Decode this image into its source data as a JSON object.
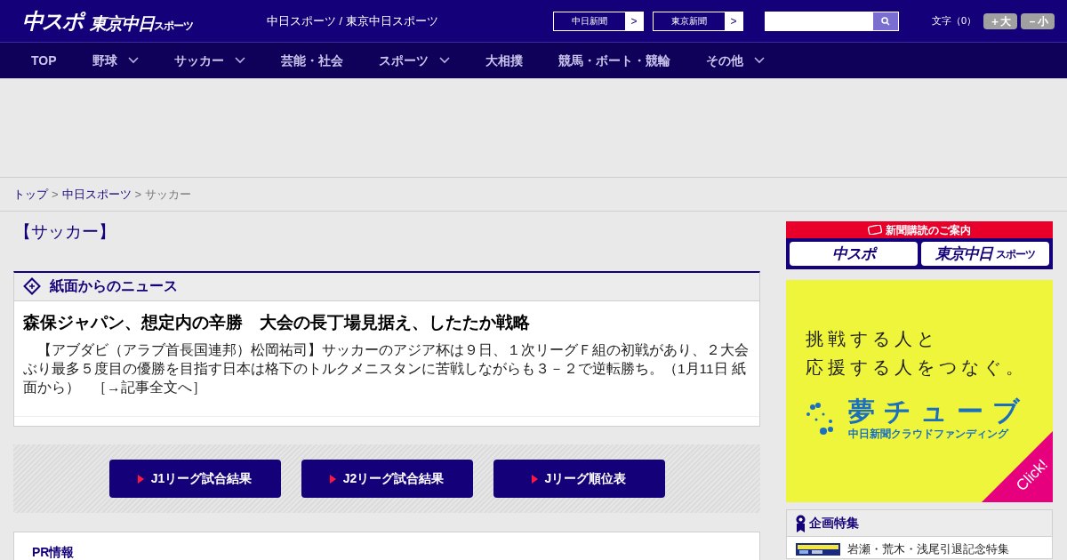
{
  "header": {
    "logo_main": "中スポ",
    "logo_tokyo": "東京中日",
    "logo_tokyo_small": "スポーツ",
    "site_title": "中日スポーツ / 東京中日スポーツ",
    "links": [
      {
        "label": "中日新聞",
        "arrow": ">"
      },
      {
        "label": "東京新聞",
        "arrow": ">"
      }
    ],
    "font_size": {
      "label": "文字（0）",
      "buttons": [
        "＋大",
        "－小"
      ]
    }
  },
  "nav": [
    {
      "label": "TOP",
      "dropdown": false
    },
    {
      "label": "野球",
      "dropdown": true
    },
    {
      "label": "サッカー",
      "dropdown": true
    },
    {
      "label": "芸能・社会",
      "dropdown": false
    },
    {
      "label": "スポーツ",
      "dropdown": true
    },
    {
      "label": "大相撲",
      "dropdown": false
    },
    {
      "label": "競馬・ボート・競輪",
      "dropdown": false
    },
    {
      "label": "その他",
      "dropdown": true
    }
  ],
  "breadcrumb": [
    {
      "label": "トップ",
      "link": true
    },
    {
      "label": "中日スポーツ",
      "link": true
    },
    {
      "label": "サッカー",
      "link": false
    }
  ],
  "breadcrumb_separator": ">",
  "page_title": "【サッカー】",
  "news_section": {
    "title": "紙面からのニュース",
    "headline": "森保ジャパン、想定内の辛勝　大会の長丁場見据え、したたか戦略",
    "body": "　【アブダビ（アラブ首長国連邦）松岡祐司】サッカーのアジア杯は９日、１次リーグＦ組の初戦があり、２大会ぶり最多５度目の優勝を目指す日本は格下のトルクメニスタンに苦戦しながらも３－２で逆転勝ち。（1月11日 紙面から）",
    "more_link": "［→記事全文へ］"
  },
  "result_buttons": [
    "J1リーグ試合結果",
    "J2リーグ試合結果",
    "Jリーグ順位表"
  ],
  "pr": {
    "title": "PR情報"
  },
  "sidebar": {
    "subscribe": {
      "title": "新聞購読のご案内",
      "options": [
        {
          "main": "中スポ"
        },
        {
          "main": "東京中日",
          "small": "スポーツ"
        }
      ]
    },
    "ad": {
      "lines": [
        "挑戦する人と",
        "応援する人をつなぐ。"
      ],
      "brand": "夢チューブ",
      "brand_sub": "中日新聞クラウドファンディング",
      "corner": "Click!"
    },
    "features": {
      "title": "企画特集",
      "items": [
        {
          "kind": "picture",
          "label": "岩瀬・荒木・浅尾引退記念特集"
        }
      ]
    }
  }
}
